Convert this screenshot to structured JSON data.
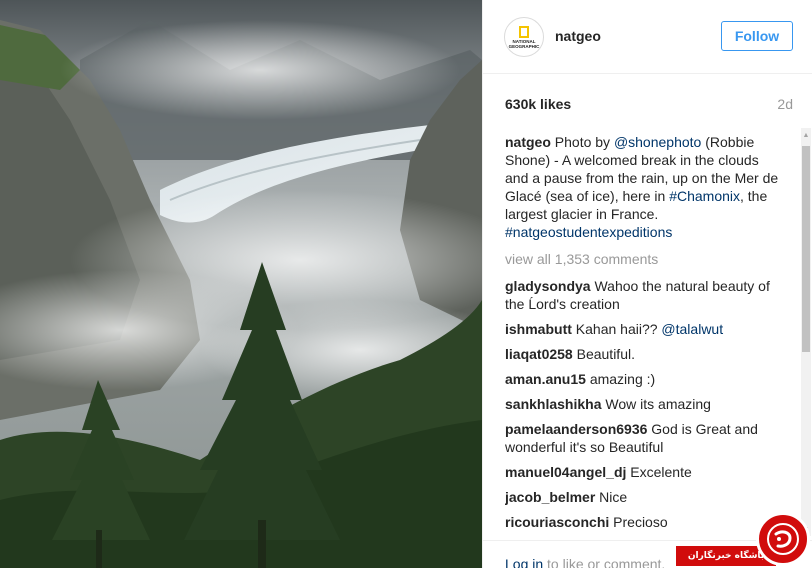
{
  "post": {
    "username": "natgeo",
    "avatar_icon": "national-geographic-logo",
    "avatar_lines": [
      "NATIONAL",
      "GEOGRAPHIC"
    ],
    "follow_label": "Follow",
    "likes": "630k likes",
    "age": "2d"
  },
  "caption": {
    "user": "natgeo",
    "parts": [
      {
        "text": " Photo by ",
        "link": false
      },
      {
        "text": "@shonephoto",
        "link": true
      },
      {
        "text": " (Robbie Shone) - A welcomed break in the clouds and a pause from the rain, up on the Mer de Glacé (sea of ice), here in ",
        "link": false
      },
      {
        "text": "#Chamonix",
        "link": true
      },
      {
        "text": ", the largest glacier in France. ",
        "link": false
      },
      {
        "text": "#natgeostudentexpeditions",
        "link": true
      }
    ]
  },
  "view_all": "view all 1,353 comments",
  "comments": [
    {
      "user": "gladysondya",
      "text": " Wahoo the natural beauty of the Ĺord's creation",
      "link": ""
    },
    {
      "user": "ishmabutt",
      "text": " Kahan haii?? ",
      "link": "@talalwut"
    },
    {
      "user": "liaqat0258",
      "text": " Beautiful.",
      "link": ""
    },
    {
      "user": "aman.anu15",
      "text": " amazing :)",
      "link": ""
    },
    {
      "user": "sankhlashikha",
      "text": " Wow its amazing",
      "link": ""
    },
    {
      "user": "pamelaanderson6936",
      "text": " God is Great and wonderful it's so Beautiful",
      "link": ""
    },
    {
      "user": "manuel04angel_dj",
      "text": " Excelente",
      "link": ""
    },
    {
      "user": "jacob_belmer",
      "text": " Nice",
      "link": ""
    },
    {
      "user": "ricouriasconchi",
      "text": " Precioso",
      "link": ""
    }
  ],
  "footer": {
    "login_link": "Log in",
    "login_rest": " to like or comment."
  },
  "watermark": {
    "text": "باشگاه خبرنگاران",
    "icon": "yjc-logo-icon"
  },
  "colors": {
    "accent": "#3897f0",
    "link": "#003569",
    "muted": "#999999",
    "watermark_red": "#d10c0c"
  }
}
